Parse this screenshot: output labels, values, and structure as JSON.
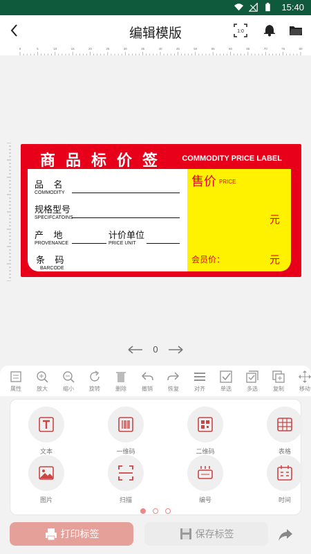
{
  "status_bar": {
    "time": "15:40"
  },
  "app_bar": {
    "title": "编辑模版",
    "scale_label": "1:0"
  },
  "ruler": {
    "top_ticks": [
      "0",
      "5",
      "10",
      "15",
      "20",
      "25",
      "30",
      "35",
      "40",
      "45",
      "50",
      "55",
      "60",
      "65",
      "70",
      "75",
      "80"
    ]
  },
  "label": {
    "header_cn": "商品标价签",
    "header_en": "COMMODITY PRICE LABEL",
    "rows": [
      {
        "cn": "品    名",
        "en": "COMMODITY"
      },
      {
        "cn": "规格型号",
        "en": "SPECIFCATOINS"
      },
      {
        "cn": "产    地",
        "en": "PROVENANCE"
      },
      {
        "cn": "条    码",
        "en": "BARCODE"
      }
    ],
    "unit_cn": "计价单位",
    "unit_en": "PRICE UNIT",
    "price_cn": "售价",
    "price_en": "PRICE",
    "yuan": "元",
    "member_price": "会员价：",
    "colors": {
      "red": "#e8001b",
      "yellow": "#fff200"
    }
  },
  "pager": {
    "page": "0"
  },
  "toolbar": [
    {
      "label": "属性",
      "icon": "properties-icon"
    },
    {
      "label": "放大",
      "icon": "zoom-in-icon"
    },
    {
      "label": "缩小",
      "icon": "zoom-out-icon"
    },
    {
      "label": "旋转",
      "icon": "rotate-icon"
    },
    {
      "label": "删除",
      "icon": "delete-icon"
    },
    {
      "label": "撤销",
      "icon": "undo-icon"
    },
    {
      "label": "恢复",
      "icon": "redo-icon"
    },
    {
      "label": "对齐",
      "icon": "align-icon"
    },
    {
      "label": "单选",
      "icon": "single-select-icon"
    },
    {
      "label": "多选",
      "icon": "multi-select-icon"
    },
    {
      "label": "复制",
      "icon": "copy-icon"
    },
    {
      "label": "移动",
      "icon": "move-icon"
    }
  ],
  "panel": {
    "items": [
      {
        "label": "文本",
        "icon": "text-icon"
      },
      {
        "label": "一维码",
        "icon": "barcode-icon"
      },
      {
        "label": "二维码",
        "icon": "qrcode-icon"
      },
      {
        "label": "表格",
        "icon": "table-icon"
      },
      {
        "label": "图片",
        "icon": "image-icon"
      },
      {
        "label": "扫描",
        "icon": "scan-icon"
      },
      {
        "label": "编号",
        "icon": "serial-number-icon"
      },
      {
        "label": "时间",
        "icon": "time-icon"
      }
    ],
    "pages": 3,
    "active_page": 1
  },
  "buttons": {
    "print": "打印标签",
    "save": "保存标签"
  }
}
